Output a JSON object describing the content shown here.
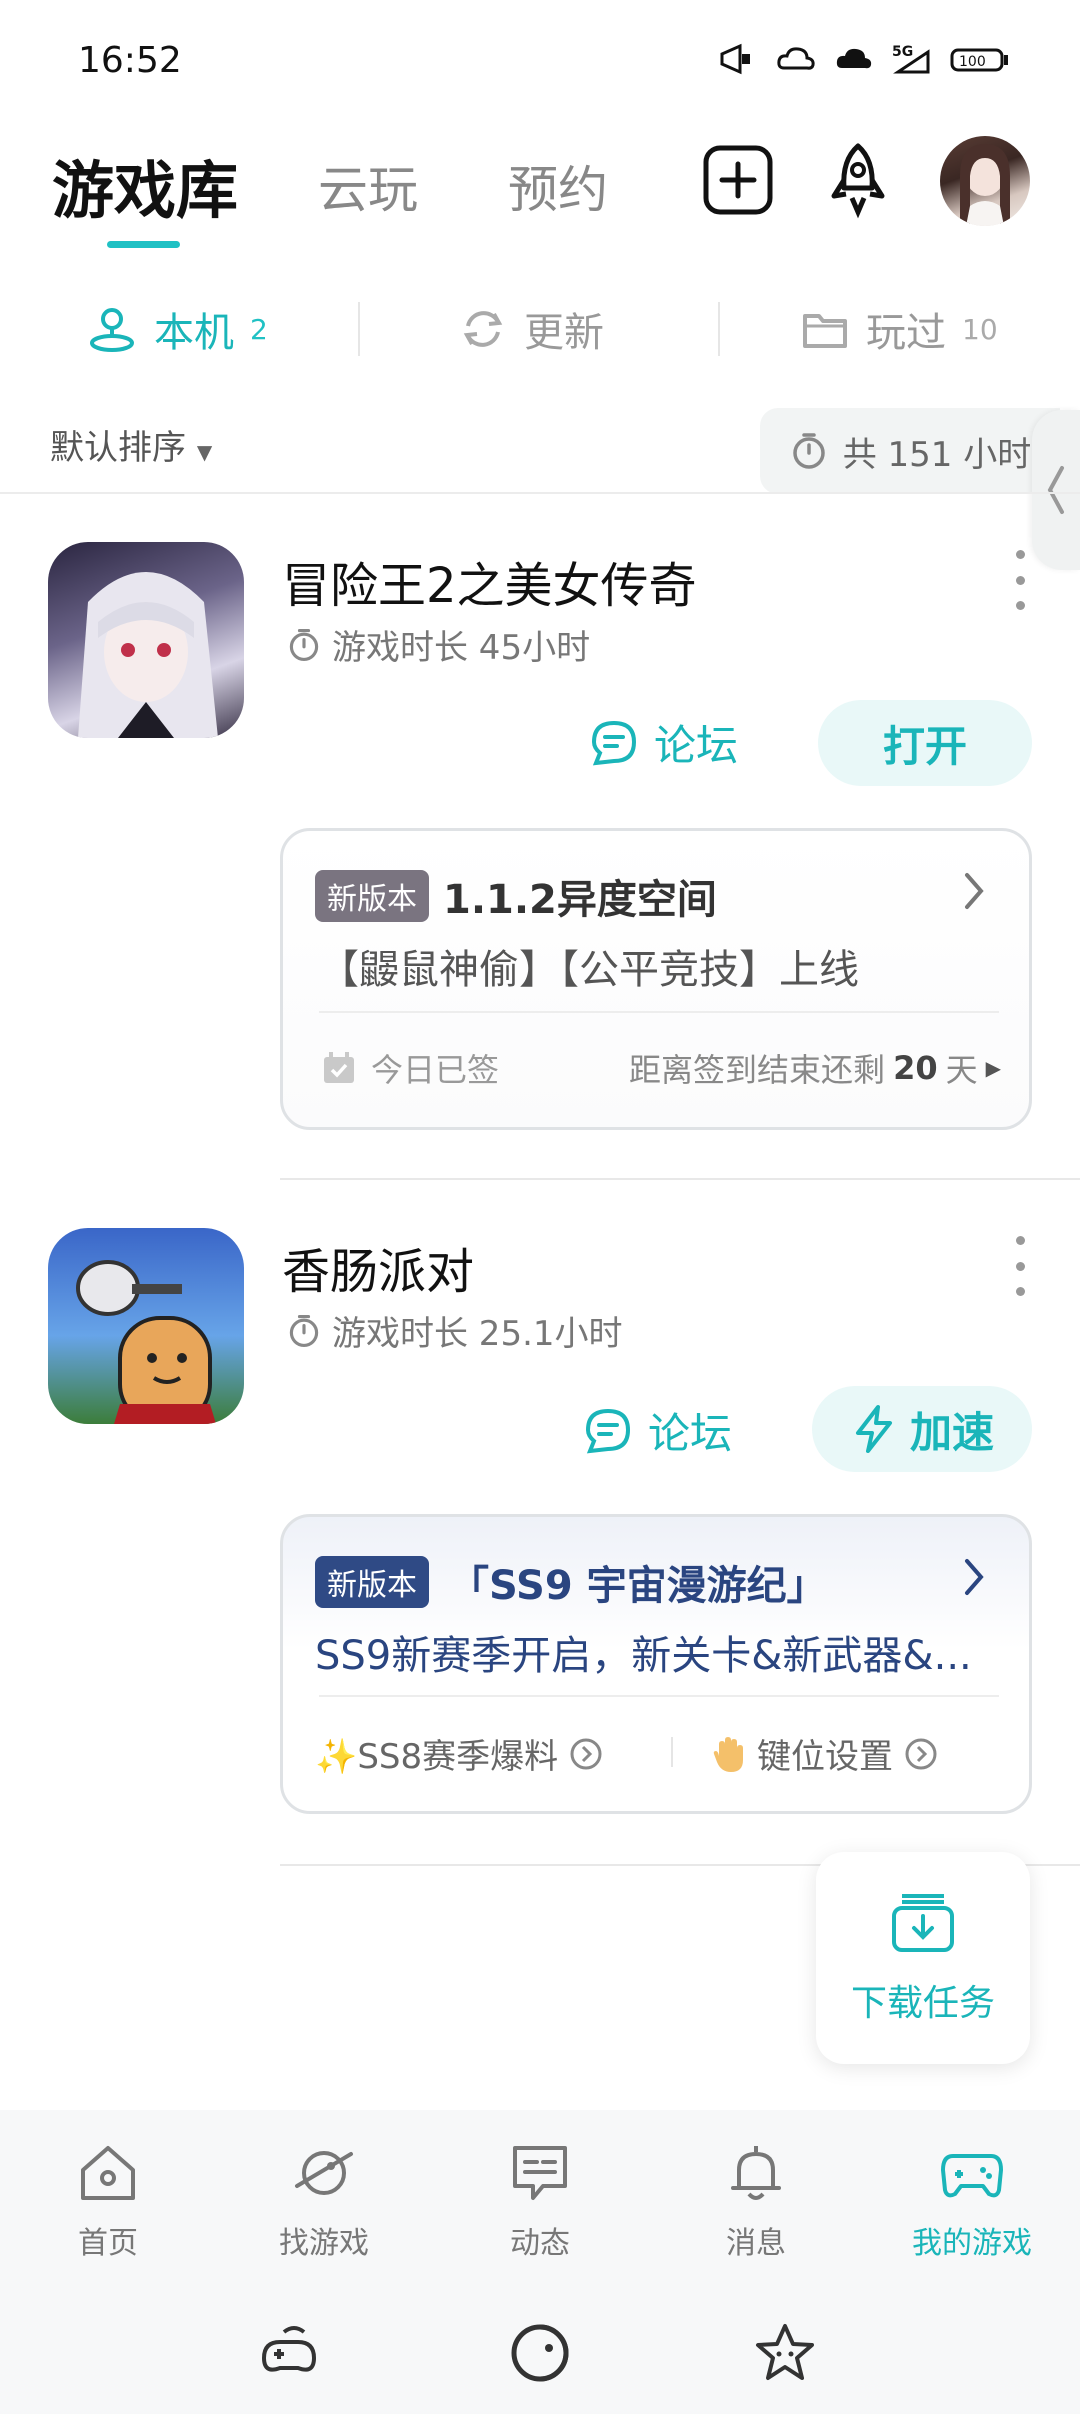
{
  "status_bar": {
    "time": "16:52",
    "icons": [
      "megaphone-icon",
      "cloud-icon",
      "cloud-game-icon",
      "5g-signal-icon",
      "battery-icon"
    ],
    "battery": "100"
  },
  "header": {
    "tabs": [
      "游戏库",
      "云玩",
      "预约"
    ],
    "active_tab": "游戏库",
    "icons": [
      "add-icon",
      "rocket-icon",
      "avatar"
    ]
  },
  "sub_tabs": [
    {
      "label": "本机",
      "count": "2",
      "icon": "location-person-icon",
      "active": true
    },
    {
      "label": "更新",
      "count": "",
      "icon": "refresh-icon",
      "active": false
    },
    {
      "label": "玩过",
      "count": "10",
      "icon": "folder-icon",
      "active": false
    }
  ],
  "sort": {
    "label": "默认排序",
    "total_time": "共 151 小时"
  },
  "games": [
    {
      "title": "冒险王2之美女传奇",
      "playtime": "游戏时长 45小时",
      "forum_label": "论坛",
      "action_label": "打开",
      "card": {
        "badge": "新版本",
        "badge_color": "#7a7480",
        "title": "1.1.2异度空间",
        "desc": "【鼹鼠神偷】【公平竞技】上线",
        "signed_label": "今日已签",
        "countdown_prefix": "距离签到结束还剩",
        "countdown_value": "20",
        "countdown_suffix": "天"
      }
    },
    {
      "title": "香肠派对",
      "playtime": "游戏时长 25.1小时",
      "forum_label": "论坛",
      "action_label": "加速",
      "card": {
        "badge": "新版本",
        "badge_color": "#2f4a85",
        "title": "「SS9 宇宙漫游纪」",
        "desc": "SS9新赛季开启，新关卡&新武器&...",
        "link1": "✨SS8赛季爆料",
        "link2": "键位设置"
      }
    }
  ],
  "download_task": "下载任务",
  "bottom_nav": [
    {
      "label": "首页",
      "icon": "home-icon"
    },
    {
      "label": "找游戏",
      "icon": "planet-icon"
    },
    {
      "label": "动态",
      "icon": "chat-card-icon"
    },
    {
      "label": "消息",
      "icon": "bell-icon"
    },
    {
      "label": "我的游戏",
      "icon": "gamepad-icon",
      "active": true
    }
  ],
  "colors": {
    "accent": "#1ab5b9",
    "text": "#111111",
    "muted": "#888888"
  }
}
